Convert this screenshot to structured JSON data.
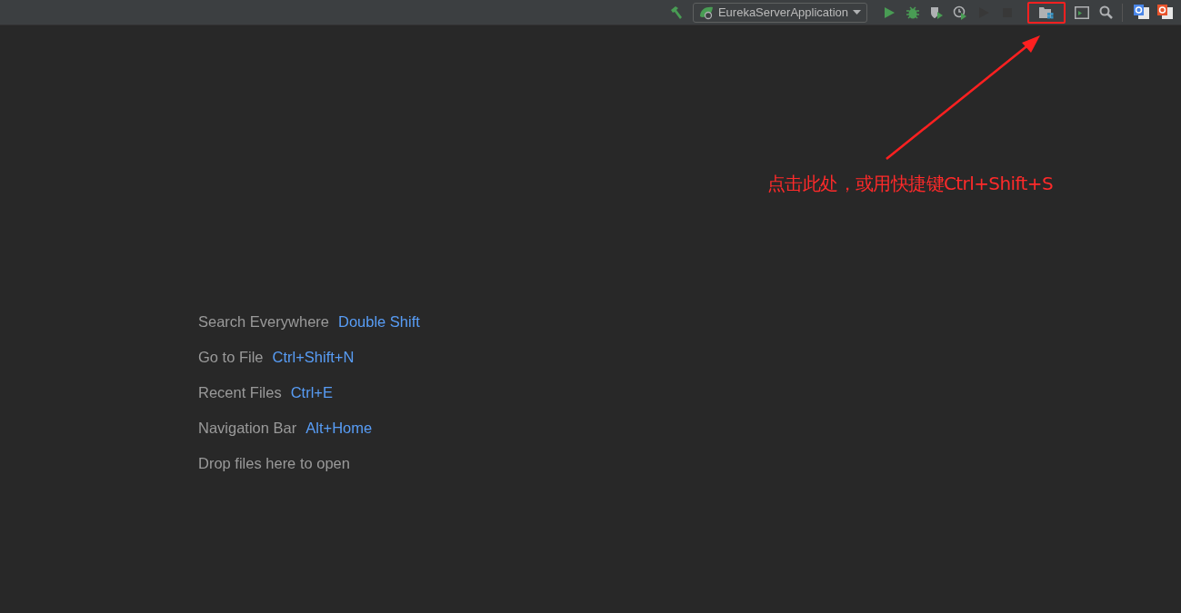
{
  "toolbar": {
    "items": [
      {
        "kind": "build",
        "disabled": false,
        "highlighted": false
      },
      {
        "kind": "config",
        "label": "EurekaServerApplication"
      },
      {
        "kind": "run",
        "disabled": false,
        "highlighted": false
      },
      {
        "kind": "debug",
        "disabled": false,
        "highlighted": false
      },
      {
        "kind": "coverage",
        "disabled": false,
        "highlighted": false
      },
      {
        "kind": "profile",
        "disabled": false,
        "highlighted": false
      },
      {
        "kind": "rerun",
        "disabled": true,
        "highlighted": false
      },
      {
        "kind": "stop",
        "disabled": true,
        "highlighted": false
      },
      {
        "kind": "structure",
        "disabled": false,
        "highlighted": true
      },
      {
        "kind": "terminal",
        "disabled": false,
        "highlighted": false
      },
      {
        "kind": "search",
        "disabled": false,
        "highlighted": false
      },
      {
        "kind": "separator"
      },
      {
        "kind": "translate",
        "disabled": false,
        "highlighted": false
      },
      {
        "kind": "translate-alt",
        "disabled": false,
        "highlighted": false
      }
    ]
  },
  "hints": [
    {
      "label": "Search Everywhere",
      "shortcut": "Double Shift"
    },
    {
      "label": "Go to File",
      "shortcut": "Ctrl+Shift+N"
    },
    {
      "label": "Recent Files",
      "shortcut": "Ctrl+E"
    },
    {
      "label": "Navigation Bar",
      "shortcut": "Alt+Home"
    },
    {
      "label": "Drop files here to open"
    }
  ],
  "annotation": {
    "text": "点击此处，或用快捷键Ctrl+Shift+S"
  }
}
